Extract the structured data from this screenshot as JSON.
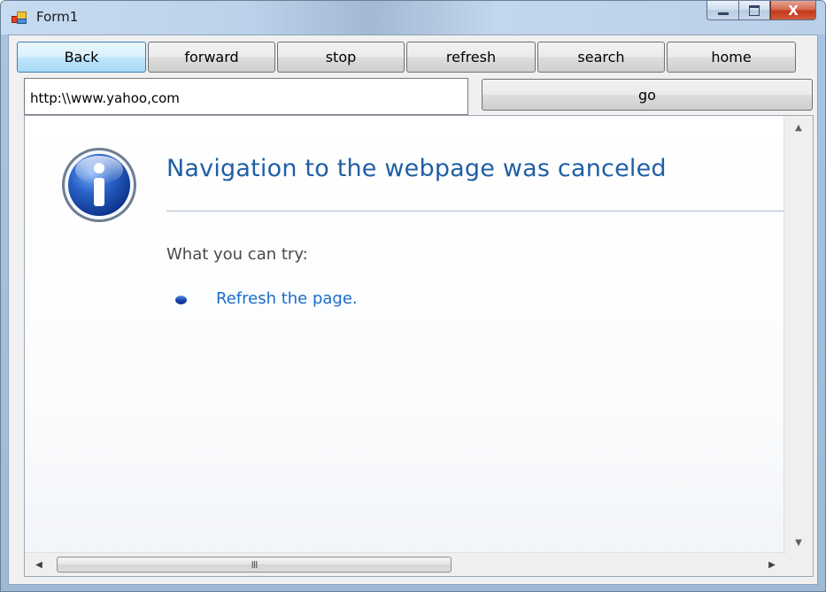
{
  "window": {
    "title": "Form1"
  },
  "caption": {
    "minimize_icon": "minimize-icon",
    "maximize_icon": "maximize-icon",
    "close_icon": "close-icon",
    "close_glyph": "X"
  },
  "toolbar": {
    "buttons": [
      {
        "label": "Back"
      },
      {
        "label": "forward"
      },
      {
        "label": "stop"
      },
      {
        "label": "refresh"
      },
      {
        "label": "search"
      },
      {
        "label": "home"
      }
    ]
  },
  "address": {
    "value": "http:\\\\www.yahoo,com",
    "go_label": "go"
  },
  "page": {
    "title": "Navigation to the webpage was canceled",
    "try_label": "What you can try:",
    "suggestions": [
      {
        "text": "Refresh the page."
      }
    ]
  },
  "scrollbars": {
    "grip": "III"
  },
  "colors": {
    "title_blue": "#1f5fa5",
    "link_blue": "#1a6cc8",
    "close_red": "#c2391a",
    "active_button": "#bee6fd"
  }
}
